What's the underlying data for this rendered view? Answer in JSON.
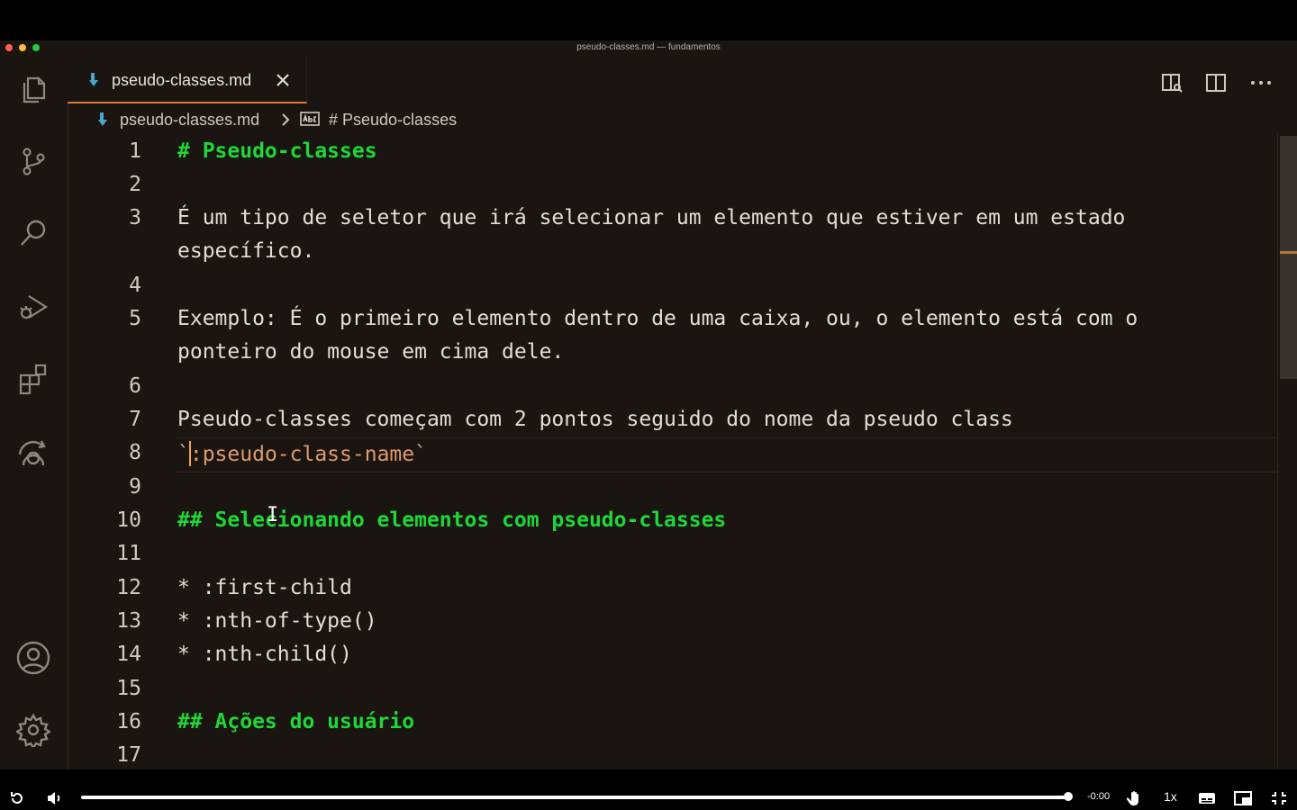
{
  "window": {
    "title": "pseudo-classes.md — fundamentos"
  },
  "tab": {
    "label": "pseudo-classes.md"
  },
  "breadcrumb": {
    "file": "pseudo-classes.md",
    "symbol": "# Pseudo-classes"
  },
  "editor": {
    "line_numbers": [
      "1",
      "2",
      "3",
      "4",
      "5",
      "6",
      "7",
      "8",
      "9",
      "10",
      "11",
      "12",
      "13",
      "14",
      "15",
      "16",
      "17"
    ],
    "lines": {
      "l1": "# Pseudo-classes",
      "l3a": "É um tipo de seletor que irá selecionar um elemento que estiver em um estado",
      "l3b": "específico.",
      "l5a": "Exemplo: É o primeiro elemento dentro de uma caixa, ou, o elemento está com o",
      "l5b": "ponteiro do mouse em cima dele.",
      "l7": "Pseudo-classes começam com 2 pontos seguido do nome da pseudo class",
      "l8_tick_open": "`",
      "l8_code": ":pseudo-class-name",
      "l8_tick_close": "`",
      "l10": "## Selecionando elementos com pseudo-classes",
      "l12": "* :first-child",
      "l13": "* :nth-of-type()",
      "l14": "* :nth-child()",
      "l16": "## Ações do usuário"
    }
  },
  "player": {
    "time": "-0:00",
    "speed": "1x",
    "progress": 1.0
  },
  "colors": {
    "accent": "#e0743a",
    "heading": "#1ed836",
    "inline_code": "#dd9a6a",
    "background": "#1b1511"
  },
  "icons": {
    "activity": [
      "files-icon",
      "source-control-icon",
      "search-icon",
      "run-debug-icon",
      "extensions-icon",
      "remote-explorer-icon",
      "account-icon",
      "settings-gear-icon"
    ],
    "player": [
      "replay-icon",
      "volume-icon",
      "hand-icon",
      "captions-icon",
      "picture-in-picture-icon",
      "exit-fullscreen-icon"
    ]
  }
}
